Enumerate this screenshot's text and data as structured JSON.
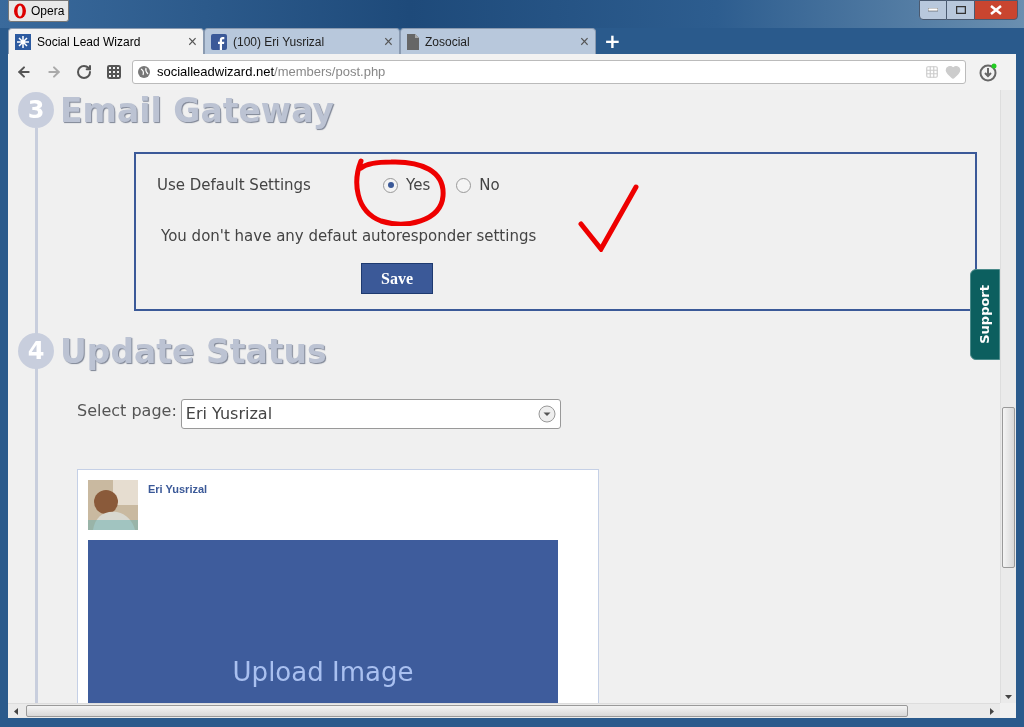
{
  "window": {
    "menu_button": "Opera"
  },
  "tabs": [
    {
      "title": "Social Lead Wizard",
      "kind": "wizard",
      "selected": true,
      "close": "×"
    },
    {
      "title": "(100) Eri Yusrizal",
      "kind": "facebook",
      "selected": false,
      "close": "×"
    },
    {
      "title": "Zosocial",
      "kind": "page",
      "selected": false,
      "close": "×"
    }
  ],
  "new_tab": "+",
  "address": {
    "domain": "socialleadwizard.net",
    "path": "/members/post.php"
  },
  "email_gateway": {
    "step": "3",
    "title": "Email Gateway",
    "label": "Use Default Settings",
    "options": [
      {
        "label": "Yes",
        "selected": true
      },
      {
        "label": "No",
        "selected": false
      }
    ],
    "message": "You don't have any defaut autoresponder settings",
    "save": "Save"
  },
  "support_tab": "Support",
  "update_status": {
    "step": "4",
    "title": "Update Status",
    "select_label": "Select page:",
    "select_value": "Eri Yusrizal",
    "post": {
      "author": "Eri Yusrizal",
      "upload": "Upload Image"
    }
  }
}
